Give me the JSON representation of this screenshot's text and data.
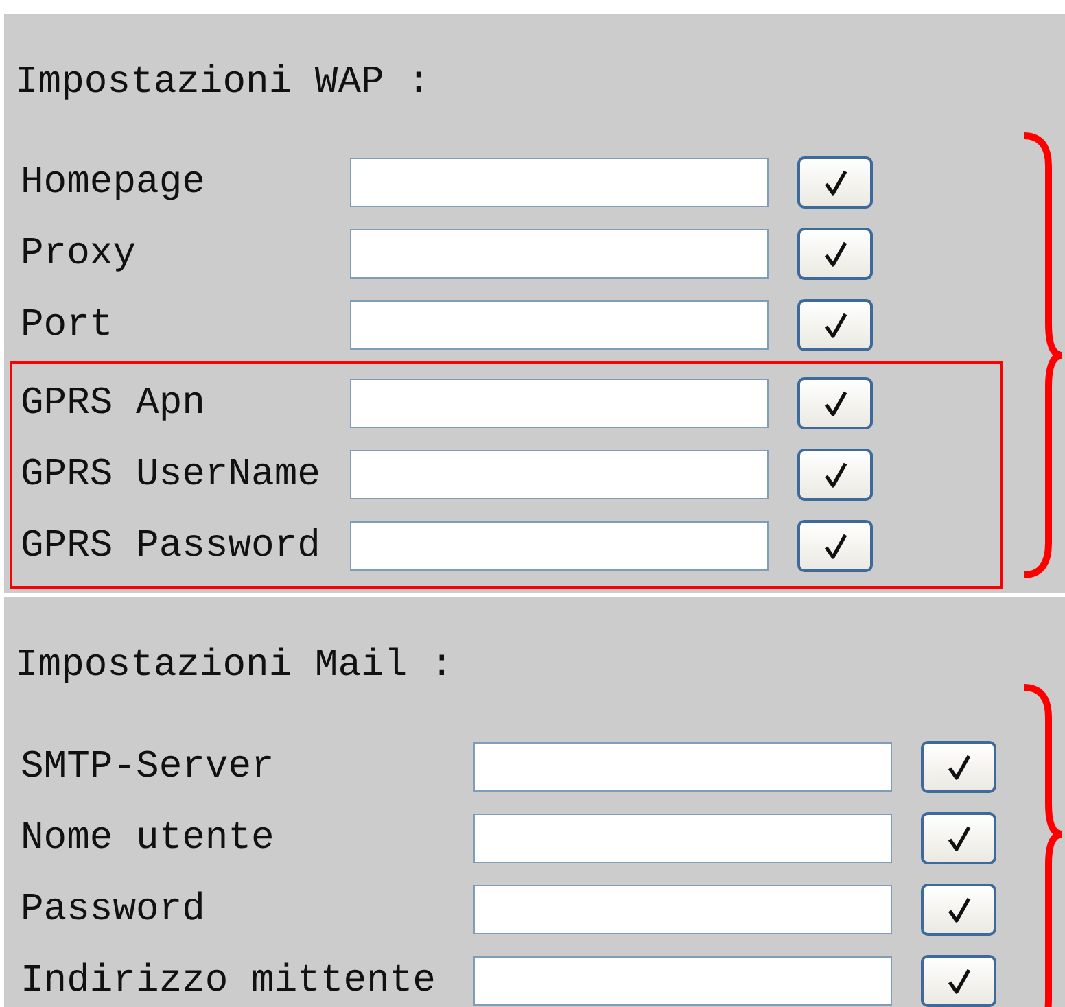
{
  "sections": [
    {
      "title": "Impostazioni WAP :",
      "kind": "wap",
      "groups": [
        {
          "highlighted": false,
          "rows": [
            {
              "label": "Homepage"
            },
            {
              "label": "Proxy"
            },
            {
              "label": "Port"
            }
          ]
        },
        {
          "highlighted": true,
          "rows": [
            {
              "label": "GPRS Apn"
            },
            {
              "label": "GPRS UserName"
            },
            {
              "label": "GPRS Password"
            }
          ]
        }
      ]
    },
    {
      "title": "Impostazioni Mail :",
      "kind": "mail",
      "groups": [
        {
          "highlighted": false,
          "rows": [
            {
              "label": "SMTP-Server"
            },
            {
              "label": "Nome utente"
            },
            {
              "label": "Password"
            },
            {
              "label": "Indirizzo mittente"
            }
          ]
        }
      ]
    }
  ]
}
